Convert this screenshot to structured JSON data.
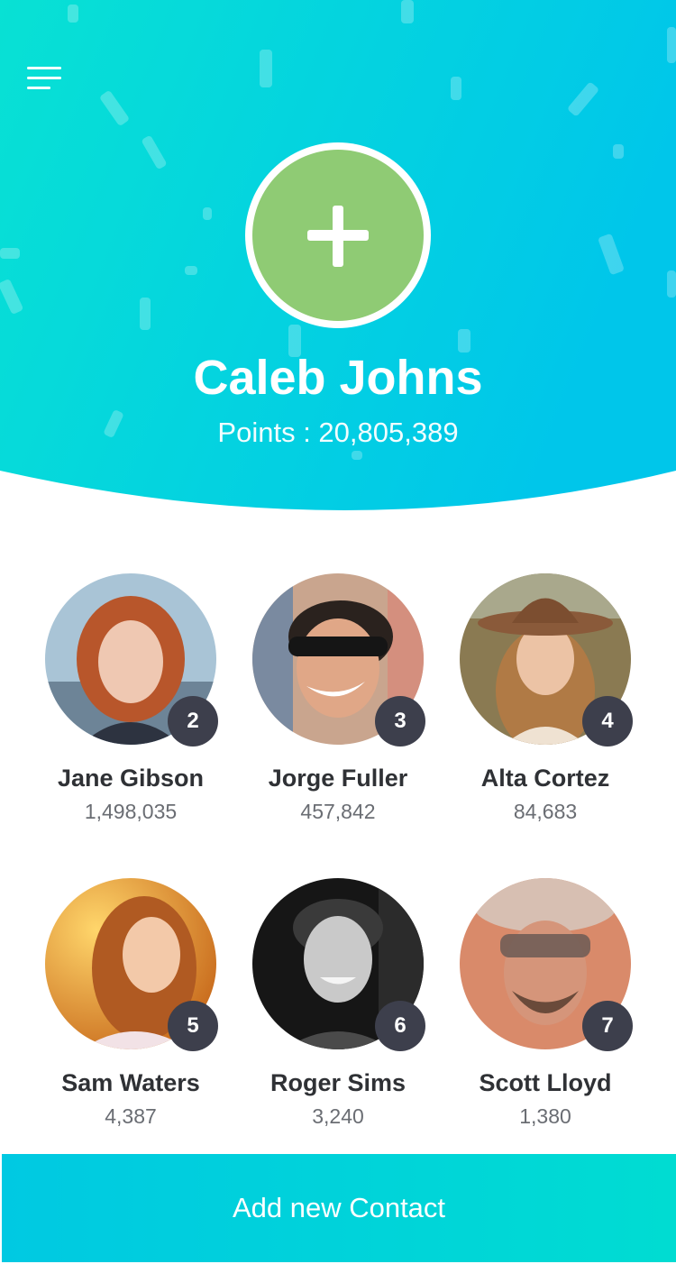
{
  "header": {
    "name": "Caleb Johns",
    "points": "Points : 20,805,389",
    "colors": {
      "gradient_start": "#08e1d4",
      "gradient_end": "#00c6ea",
      "add_button": "#8fcb74"
    },
    "menu_icon": "hamburger-menu-icon",
    "add_icon": "plus-icon"
  },
  "contacts": [
    {
      "rank": "2",
      "name": "Jane Gibson",
      "score": "1,498,035"
    },
    {
      "rank": "3",
      "name": "Jorge Fuller",
      "score": "457,842"
    },
    {
      "rank": "4",
      "name": "Alta Cortez",
      "score": "84,683"
    },
    {
      "rank": "5",
      "name": "Sam Waters",
      "score": "4,387"
    },
    {
      "rank": "6",
      "name": "Roger Sims",
      "score": "3,240"
    },
    {
      "rank": "7",
      "name": "Scott Lloyd",
      "score": "1,380"
    }
  ],
  "footer": {
    "button_label": "Add new Contact"
  }
}
